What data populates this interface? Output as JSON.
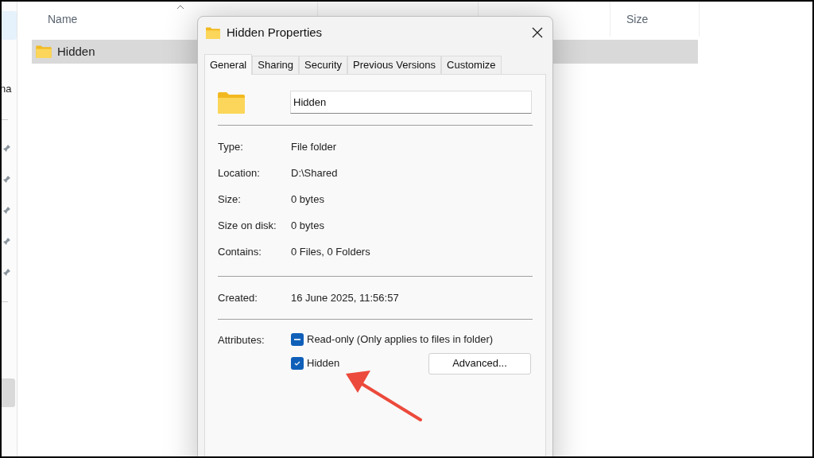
{
  "explorer": {
    "sidebar": {
      "label": "na"
    },
    "columns": [
      {
        "label": "Name",
        "sorted": true
      },
      {
        "label": "Size",
        "sorted": false
      }
    ],
    "files": [
      {
        "name": "Hidden",
        "selected": true
      }
    ]
  },
  "dialog": {
    "title": "Hidden Properties",
    "tabs": [
      {
        "label": "General",
        "selected": true
      },
      {
        "label": "Sharing",
        "selected": false
      },
      {
        "label": "Security",
        "selected": false
      },
      {
        "label": "Previous Versions",
        "selected": false
      },
      {
        "label": "Customize",
        "selected": false
      }
    ],
    "name_field": {
      "value": "Hidden"
    },
    "property_groups": [
      [
        {
          "label": "Type:",
          "value": "File folder"
        },
        {
          "label": "Location:",
          "value": "D:\\Shared"
        },
        {
          "label": "Size:",
          "value": "0 bytes"
        },
        {
          "label": "Size on disk:",
          "value": "0 bytes"
        },
        {
          "label": "Contains:",
          "value": "0 Files, 0 Folders"
        }
      ],
      [
        {
          "label": "Created:",
          "value": "16 June 2025, 11:56:57"
        }
      ]
    ],
    "attributes": {
      "label": "Attributes:",
      "checkboxes": [
        {
          "label": "Read-only (Only applies to files in folder)",
          "checked": true,
          "indeterminate": true
        },
        {
          "label": "Hidden",
          "checked": true,
          "indeterminate": false
        }
      ],
      "button": "Advanced..."
    }
  }
}
